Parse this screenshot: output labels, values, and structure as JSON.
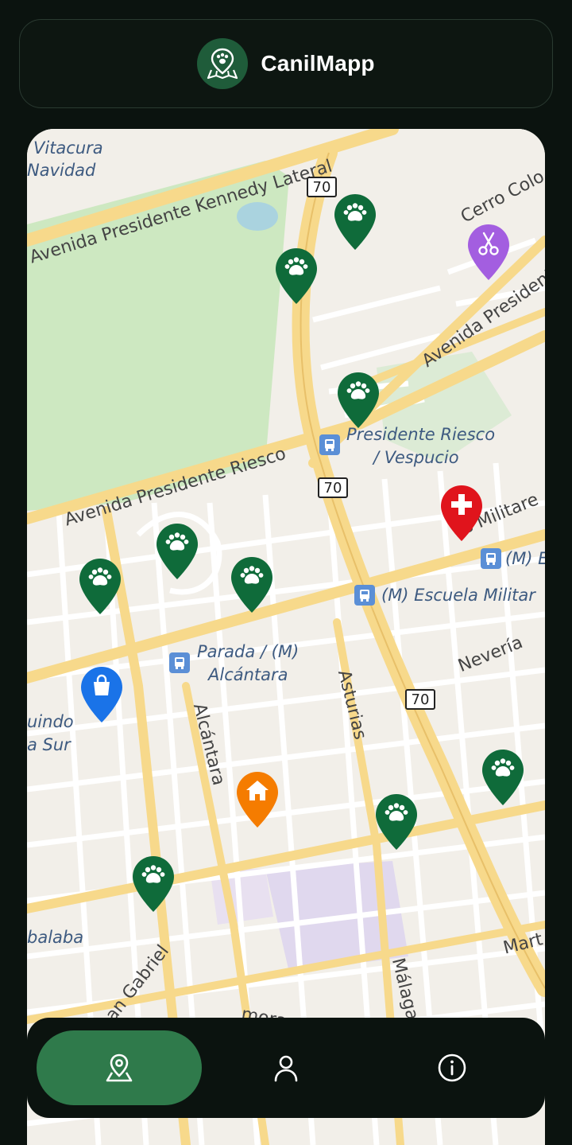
{
  "header": {
    "app_title": "CanilMapp"
  },
  "map": {
    "place_labels": [
      "Vitacura",
      "Navidad",
      "Presidente Riesco",
      "/ Vespucio",
      "(M) Escuela Militar",
      "(M) E",
      "Parada / (M)",
      "Alcántara",
      "uindo",
      "a Sur",
      "balaba"
    ],
    "road_labels": [
      "Avenida Presidente Kennedy Lateral",
      "Avenida Presidente Riesco",
      "Avenida President",
      "Cerro Colo",
      "s Militare",
      "Nevería",
      "Asturias",
      "Alcántara",
      "Málaga",
      "an Gabriel",
      "Mart",
      "mora"
    ],
    "route_shields": [
      "70",
      "70",
      "70"
    ],
    "markers": [
      {
        "type": "dog",
        "icon": "paw-icon",
        "color": "#0f6b3a"
      },
      {
        "type": "dog",
        "icon": "paw-icon",
        "color": "#0f6b3a"
      },
      {
        "type": "dog",
        "icon": "paw-icon",
        "color": "#0f6b3a"
      },
      {
        "type": "dog",
        "icon": "paw-icon",
        "color": "#0f6b3a"
      },
      {
        "type": "dog",
        "icon": "paw-icon",
        "color": "#0f6b3a"
      },
      {
        "type": "dog",
        "icon": "paw-icon",
        "color": "#0f6b3a"
      },
      {
        "type": "dog",
        "icon": "paw-icon",
        "color": "#0f6b3a"
      },
      {
        "type": "dog",
        "icon": "paw-icon",
        "color": "#0f6b3a"
      },
      {
        "type": "dog",
        "icon": "paw-icon",
        "color": "#0f6b3a"
      },
      {
        "type": "grooming",
        "icon": "scissors-icon",
        "color": "#a35ee0"
      },
      {
        "type": "veterinary",
        "icon": "medical-cross-icon",
        "color": "#e0141c"
      },
      {
        "type": "pet-shop",
        "icon": "shopping-bag-icon",
        "color": "#1a73e8"
      },
      {
        "type": "shelter",
        "icon": "home-icon",
        "color": "#f57c00"
      }
    ]
  },
  "bottom_nav": {
    "items": [
      {
        "name": "map",
        "icon": "map-pin-icon",
        "active": true
      },
      {
        "name": "profile",
        "icon": "user-icon",
        "active": false
      },
      {
        "name": "info",
        "icon": "info-icon",
        "active": false
      }
    ]
  },
  "colors": {
    "background": "#0b130f",
    "accent": "#2f7a4b",
    "logo_bg": "#1f5c3a"
  }
}
